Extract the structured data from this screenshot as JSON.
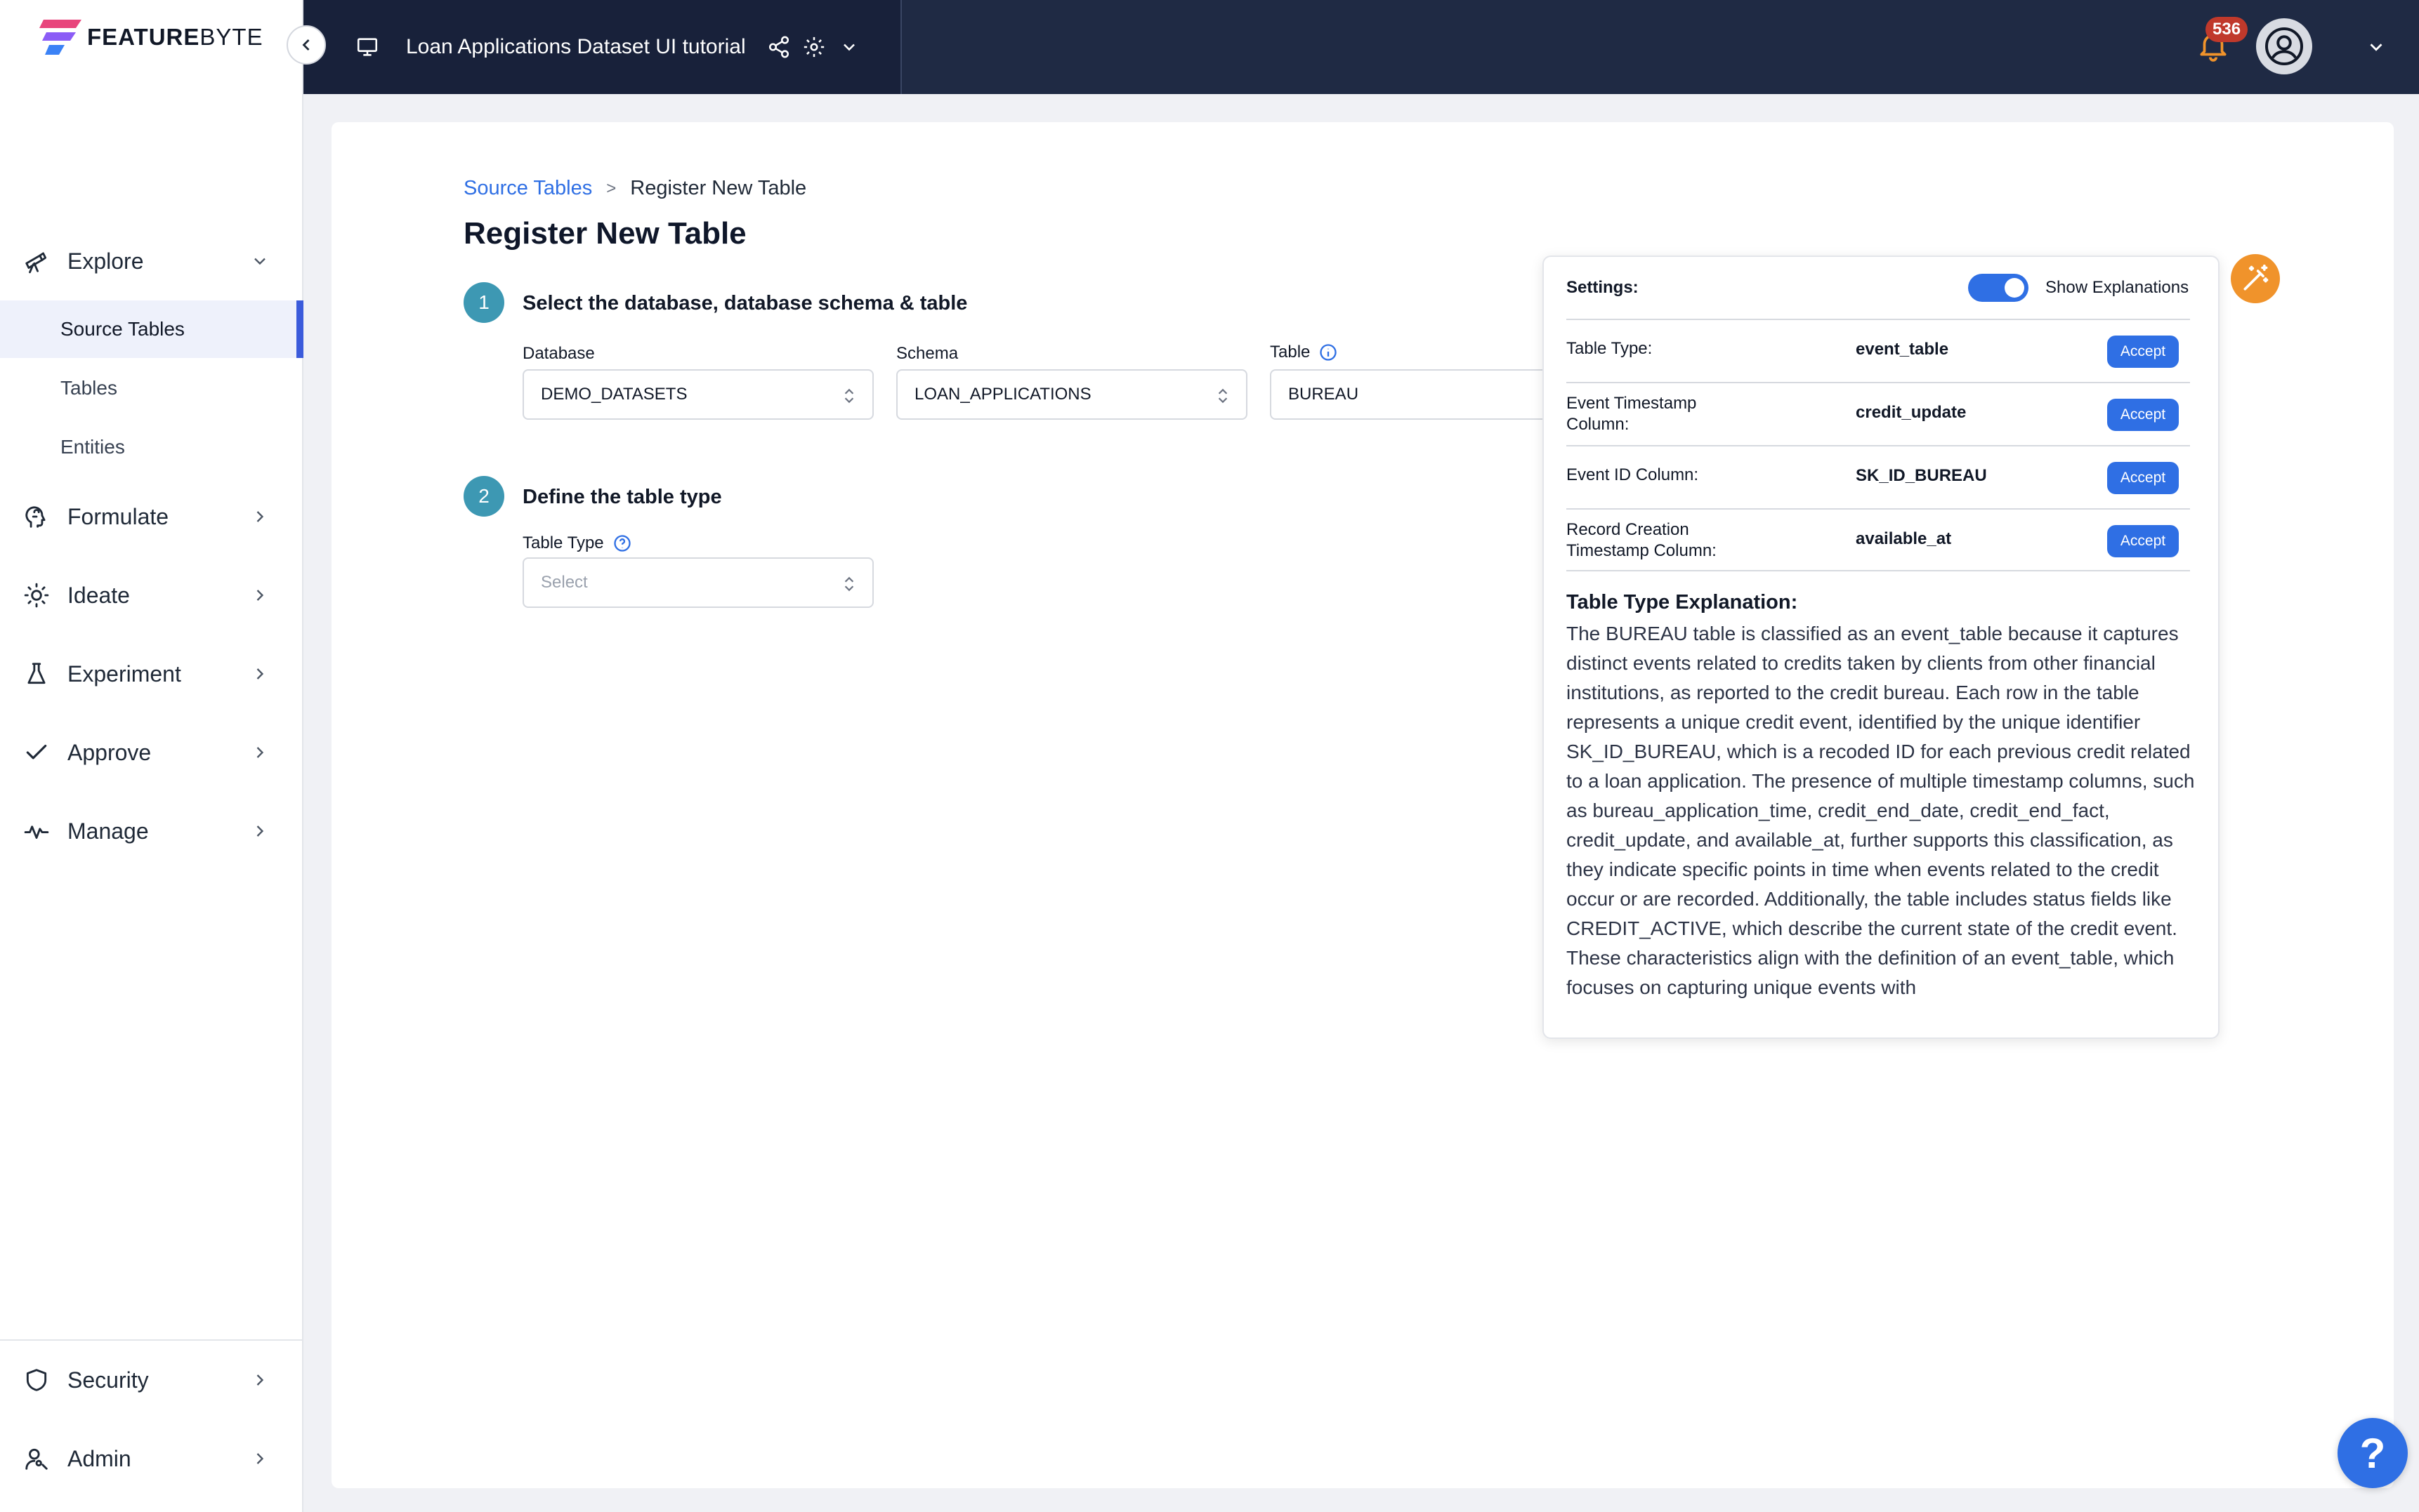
{
  "brand": {
    "name_part1": "FEATURE",
    "name_part2": "BYTE"
  },
  "topbar": {
    "project_title": "Loan Applications Dataset UI tutorial",
    "notification_count": "536"
  },
  "sidebar": {
    "explore": "Explore",
    "explore_items": [
      "Source Tables",
      "Tables",
      "Entities"
    ],
    "formulate": "Formulate",
    "ideate": "Ideate",
    "experiment": "Experiment",
    "approve": "Approve",
    "manage": "Manage",
    "security": "Security",
    "admin": "Admin"
  },
  "breadcrumb": {
    "parent": "Source Tables",
    "separator": ">",
    "current": "Register New Table"
  },
  "page_title": "Register New Table",
  "step1": {
    "number": "1",
    "title": "Select the database, database schema & table",
    "database_label": "Database",
    "database_value": "DEMO_DATASETS",
    "schema_label": "Schema",
    "schema_value": "LOAN_APPLICATIONS",
    "table_label": "Table",
    "table_value": "BUREAU"
  },
  "step2": {
    "number": "2",
    "title": "Define the table type",
    "table_type_label": "Table Type",
    "table_type_placeholder": "Select"
  },
  "panel": {
    "settings_label": "Settings:",
    "toggle_label": "Show Explanations",
    "toggle_on": true,
    "rows": [
      {
        "key": "Table Type:",
        "value": "event_table",
        "action": "Accept"
      },
      {
        "key": "Event Timestamp Column:",
        "value": "credit_update",
        "action": "Accept"
      },
      {
        "key": "Event ID Column:",
        "value": "SK_ID_BUREAU",
        "action": "Accept"
      },
      {
        "key": "Record Creation Timestamp Column:",
        "value": "available_at",
        "action": "Accept"
      }
    ],
    "explanation_title": "Table Type Explanation:",
    "explanation_text": "The BUREAU table is classified as an event_table because it captures distinct events related to credits taken by clients from other financial institutions, as reported to the credit bureau. Each row in the table represents a unique credit event, identified by the unique identifier SK_ID_BUREAU, which is a recoded ID for each previous credit related to a loan application. The presence of multiple timestamp columns, such as bureau_application_time, credit_end_date, credit_end_fact, credit_update, and available_at, further supports this classification, as they indicate specific points in time when events related to the credit occur or are recorded. Additionally, the table includes status fields like CREDIT_ACTIVE, which describe the current state of the credit event. These characteristics align with the definition of an event_table, which focuses on capturing unique events with"
  },
  "help_label": "?",
  "colors": {
    "accent": "#2f6fe4",
    "topbar": "#1f2a44",
    "step": "#3d98b3",
    "wand": "#f0932b",
    "badge": "#c0392b"
  }
}
